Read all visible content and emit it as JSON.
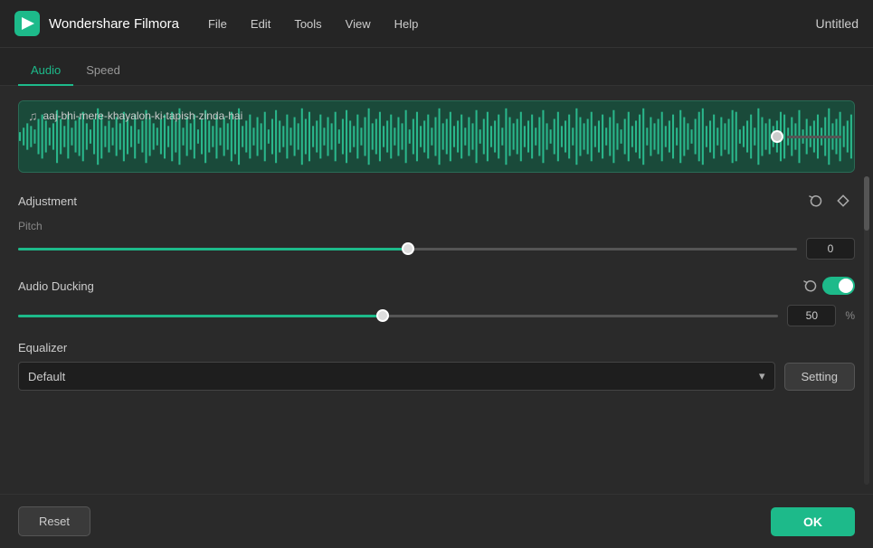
{
  "titlebar": {
    "app_name": "Wondershare Filmora",
    "menu": [
      "File",
      "Edit",
      "Tools",
      "View",
      "Help"
    ],
    "title": "Untitled"
  },
  "tabs": [
    {
      "label": "Audio",
      "active": true
    },
    {
      "label": "Speed",
      "active": false
    }
  ],
  "waveform": {
    "filename": "aaj-bhi-mere-khayalon-ki-tapish-zinda-hai"
  },
  "adjustment": {
    "label": "Adjustment",
    "reset_icon": "↺",
    "diamond_icon": "◇"
  },
  "pitch": {
    "label": "Pitch",
    "value": "0",
    "slider_percent": 50
  },
  "audio_ducking": {
    "label": "Audio Ducking",
    "value": "50",
    "unit": "%",
    "slider_percent": 48,
    "enabled": true,
    "reset_icon": "↺"
  },
  "equalizer": {
    "label": "Equalizer",
    "selected": "Default",
    "chevron": "▾",
    "setting_label": "Setting"
  },
  "bottom": {
    "reset_label": "Reset",
    "ok_label": "OK"
  }
}
